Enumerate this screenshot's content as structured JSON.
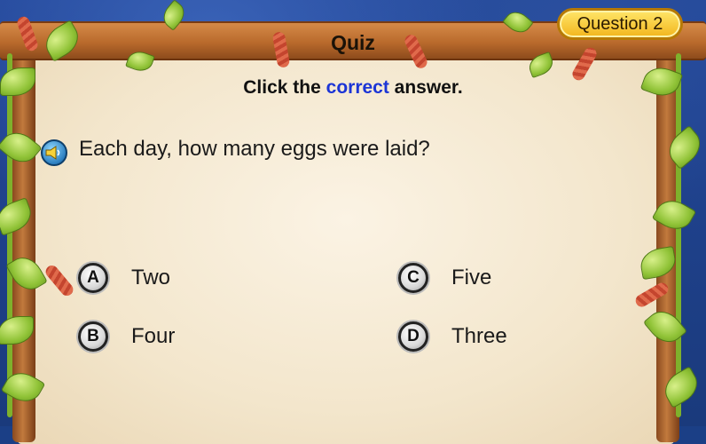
{
  "header": {
    "title": "Quiz",
    "question_badge": "Question 2"
  },
  "instruction": {
    "before": "Click the ",
    "highlight": "correct",
    "after": " answer."
  },
  "question": {
    "text": "Each day, how many eggs were laid?",
    "audio_icon": "speaker-icon"
  },
  "options": [
    {
      "letter": "A",
      "text": "Two"
    },
    {
      "letter": "B",
      "text": "Four"
    },
    {
      "letter": "C",
      "text": "Five"
    },
    {
      "letter": "D",
      "text": "Three"
    }
  ],
  "colors": {
    "highlight": "#1c35d6",
    "badge": "#f2b51c",
    "board": "#f3e6cc"
  }
}
